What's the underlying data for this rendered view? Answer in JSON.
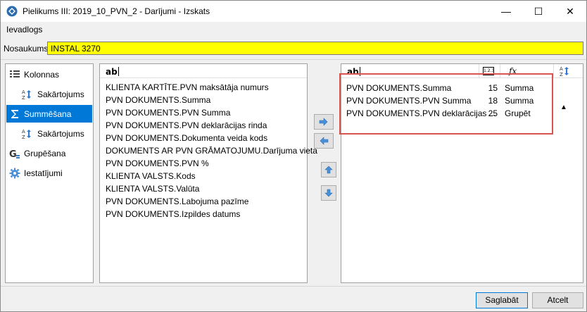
{
  "window": {
    "title": "Pielikums III: 2019_10_PVN_2 - Darījumi - Izskats",
    "minimize": "—",
    "maximize": "☐",
    "close": "✕"
  },
  "menu": {
    "item": "Ievadlogs"
  },
  "name_field": {
    "label": "Nosaukums:",
    "value": "INSTAL 3270"
  },
  "nav": {
    "items": [
      {
        "label": "Kolonnas",
        "icon": "columns-icon"
      },
      {
        "label": "Sakārtojums",
        "icon": "sort-az-icon"
      },
      {
        "label": "Summēšana",
        "icon": "sum-icon"
      },
      {
        "label": "Sakārtojums",
        "icon": "sort-az-icon"
      },
      {
        "label": "Grupēšana",
        "icon": "group-icon"
      },
      {
        "label": "Iestatījumi",
        "icon": "gear-icon"
      }
    ],
    "selected_index": 2
  },
  "available": {
    "header_icon": "ab",
    "items": [
      "KLIENTA KARTĪTE.PVN maksātāja numurs",
      "PVN DOKUMENTS.Summa",
      "PVN DOKUMENTS.PVN Summa",
      "PVN DOKUMENTS.PVN deklarācijas rinda",
      "PVN DOKUMENTS.Dokumenta veida kods",
      "DOKUMENTS AR PVN GRĀMATOJUMU.Darījuma vieta",
      "PVN DOKUMENTS.PVN %",
      "KLIENTA VALSTS.Kods",
      "KLIENTA VALSTS.Valūta",
      "PVN DOKUMENTS.Labojuma pazīme",
      "PVN DOKUMENTS.Izpildes datums"
    ]
  },
  "selected": {
    "header_icon": "ab",
    "width_icon": "1.2.3",
    "func_icon": "fx",
    "rows": [
      {
        "name": "PVN DOKUMENTS.Summa",
        "width": "15",
        "func": "Summa",
        "sort": ""
      },
      {
        "name": "PVN DOKUMENTS.PVN Summa",
        "width": "18",
        "func": "Summa",
        "sort": ""
      },
      {
        "name": "PVN DOKUMENTS.PVN deklarācijas ...",
        "width": "25",
        "func": "Grupēt",
        "sort": "▲"
      }
    ]
  },
  "buttons": {
    "save": "Saglabāt",
    "cancel": "Atcelt"
  },
  "colors": {
    "accent": "#0078d7",
    "name_bg": "#ffff00",
    "highlight": "#d9534f"
  }
}
